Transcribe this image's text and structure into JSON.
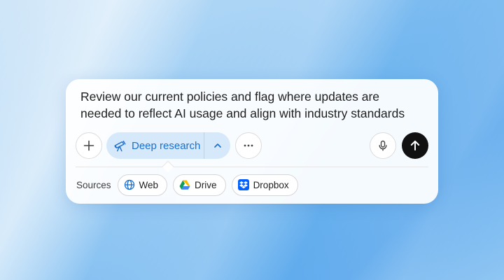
{
  "composer": {
    "prompt_text": "Review our current policies and flag where updates are needed to reflect AI usage and align with industry standards"
  },
  "toolbar": {
    "add_icon": "plus-icon",
    "mode": {
      "label": "Deep research",
      "icon": "telescope-icon",
      "toggle_icon": "chevron-up-icon",
      "color": "#1a6fd1"
    },
    "more_icon": "ellipsis-icon",
    "mic_icon": "microphone-icon",
    "send_icon": "arrow-up-icon"
  },
  "sources": {
    "label": "Sources",
    "items": [
      {
        "label": "Web",
        "icon": "globe-icon"
      },
      {
        "label": "Drive",
        "icon": "google-drive-icon"
      },
      {
        "label": "Dropbox",
        "icon": "dropbox-icon"
      }
    ]
  }
}
